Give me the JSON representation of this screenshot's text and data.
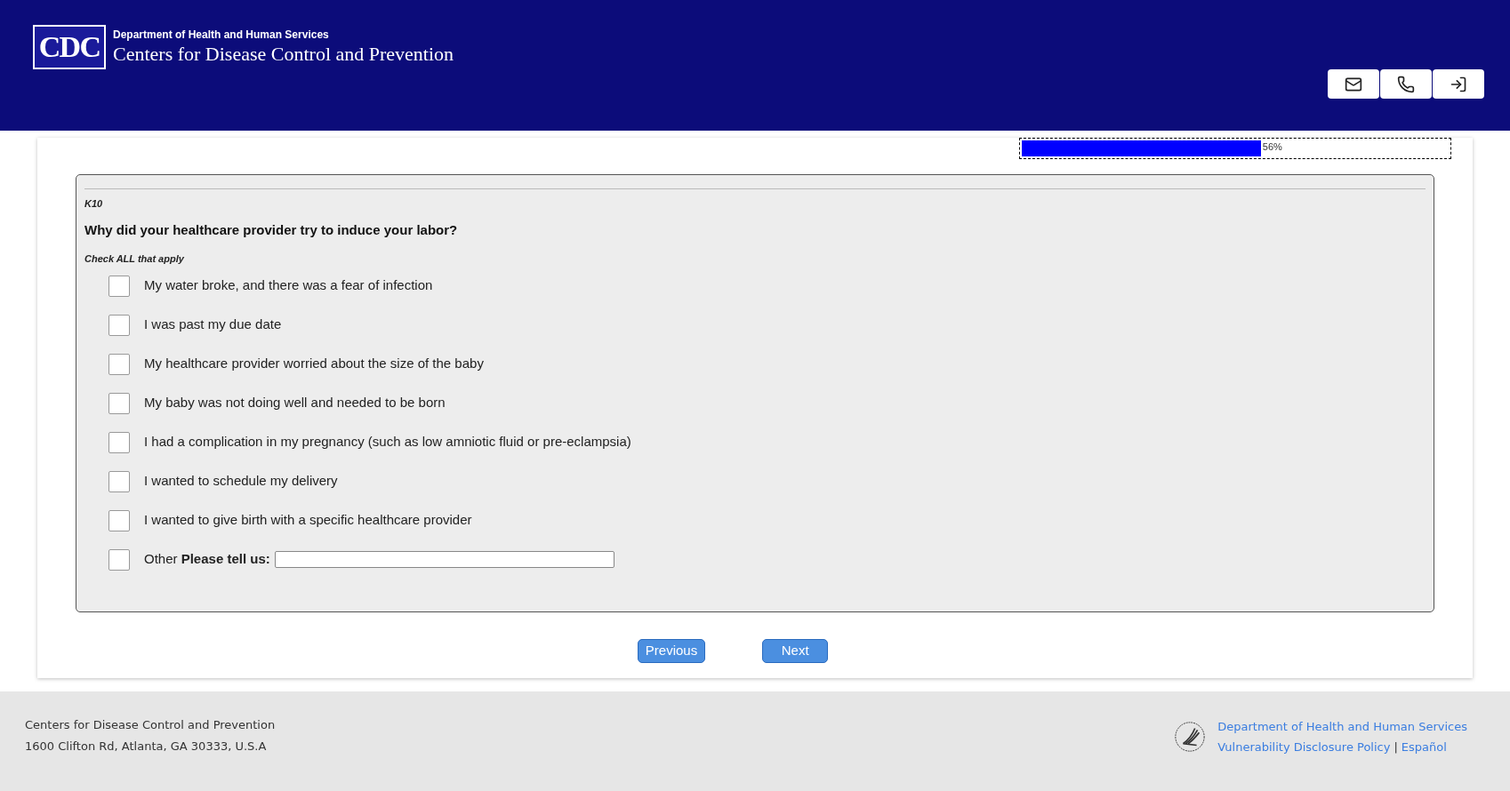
{
  "header": {
    "logo": "CDC",
    "department": "Department of Health and Human Services",
    "agency": "Centers for Disease Control and Prevention",
    "actions": [
      {
        "kind": "mail"
      },
      {
        "kind": "phone"
      },
      {
        "kind": "signin"
      }
    ]
  },
  "progress": {
    "level": 0.56,
    "reading": "56%"
  },
  "question": {
    "code": "K10",
    "text": "Why did your healthcare provider try to induce your labor?",
    "instruction": "Check ALL that apply",
    "options": [
      {
        "kind": "plain",
        "label": "My water broke, and there was a fear of infection",
        "checked": false
      },
      {
        "kind": "plain",
        "label": "I was past my due date",
        "checked": false
      },
      {
        "kind": "plain",
        "label": "My healthcare provider worried about the size of the baby",
        "checked": false
      },
      {
        "kind": "plain",
        "label": "My baby was not doing well and needed to be born",
        "checked": false
      },
      {
        "kind": "plain",
        "label": "I had a complication in my pregnancy (such as low amniotic fluid or pre-eclampsia)",
        "checked": false
      },
      {
        "kind": "plain",
        "label": "I wanted to schedule my delivery",
        "checked": false
      },
      {
        "kind": "plain",
        "label": "I wanted to give birth with a specific healthcare provider",
        "checked": false
      },
      {
        "kind": "other",
        "label": "Other **Please tell us:**",
        "checked": false
      }
    ]
  },
  "buttons": [
    "Previous",
    "Next"
  ],
  "footer": {
    "lines": [
      "Centers for Disease Control and Prevention",
      "1600 Clifton Rd, Atlanta, GA 30333, U.S.A"
    ],
    "links": [
      "Department of Health and Human Services",
      "Vulnerability Disclosure Policy",
      "Español"
    ],
    "separator": "|"
  }
}
